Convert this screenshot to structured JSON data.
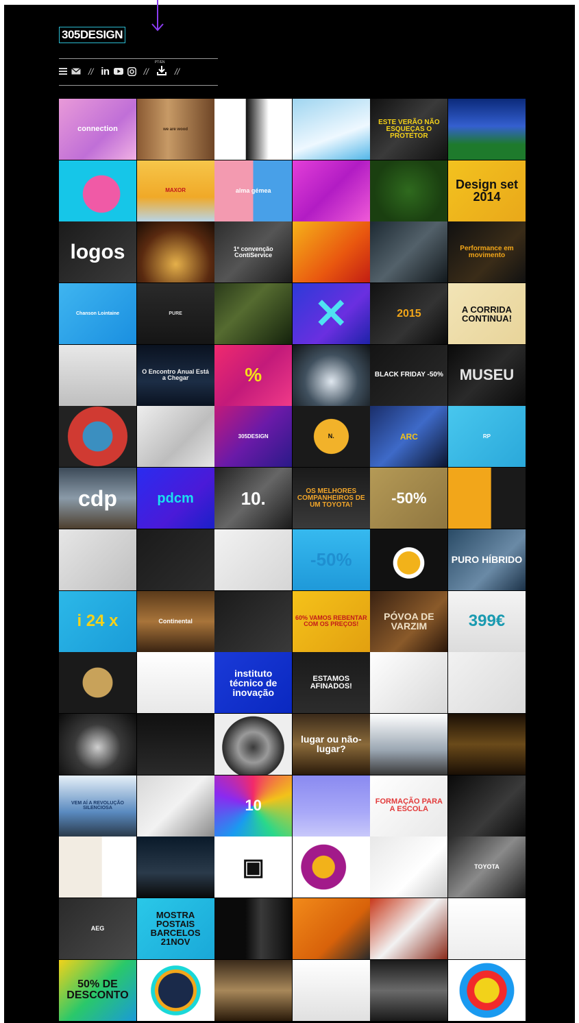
{
  "header": {
    "logo_text": "305DESIGN",
    "menu": {
      "hamburger_icon": "hamburger-icon",
      "mail_icon": "mail-icon",
      "sep1": "//",
      "linkedin_text": "in",
      "youtube_icon": "youtube-icon",
      "instagram_icon": "instagram-icon",
      "sep2": "//",
      "download_caption": "PT/EN",
      "download_icon": "download-icon",
      "sep3": "//"
    }
  },
  "colors": {
    "background": "#000000",
    "accent_cyan": "#2bbcd2",
    "arrow_purple": "#8a3cf0"
  },
  "tiles": [
    {
      "text": "connection",
      "bg": "linear-gradient(135deg,#e99ad8,#c06fd7 60%,#f1b1e4)",
      "fg": "#ffffff",
      "size": 11
    },
    {
      "text": "we are wood",
      "bg": "linear-gradient(90deg,#8a5a33,#c79a66 40%,#6e4526)",
      "fg": "#3a2412",
      "size": 6
    },
    {
      "text": "",
      "bg": "linear-gradient(90deg,#ffffff 40%,#111111 41%,#ffffff 70%)",
      "fg": "#000",
      "size": 9
    },
    {
      "text": "",
      "bg": "linear-gradient(160deg,#9fd5f0,#eef8ff 60%,#52b6e8)",
      "fg": "#000",
      "size": 9
    },
    {
      "text": "ESTE VERÃO NÃO ESQUEÇAS O PROTETOR",
      "bg": "linear-gradient(135deg,#111,#3a3a3a 50%,#111)",
      "fg": "#f5d21a",
      "size": 10
    },
    {
      "text": "",
      "bg": "linear-gradient(180deg,#0b2a7a,#345fd0 45%,#1e7a2c 75%)",
      "fg": "#fff",
      "size": 9
    },
    {
      "text": "",
      "bg": "radial-gradient(circle at 55% 55%,#f05aa6 0 34%,#16c6e8 35%)",
      "fg": "#fff",
      "size": 9
    },
    {
      "text": "MAXOR",
      "bg": "linear-gradient(180deg,#f6c64a,#f0a928 60%,#b8d4e6)",
      "fg": "#c2161b",
      "size": 8
    },
    {
      "text": "alma gémea",
      "bg": "linear-gradient(90deg,#f39ab0 50%,#48a0e8 50%)",
      "fg": "#ffffff",
      "size": 9
    },
    {
      "text": "",
      "bg": "linear-gradient(135deg,#e33fd8,#b21cc4 50%,#f05ad8)",
      "fg": "#fff",
      "size": 9
    },
    {
      "text": "",
      "bg": "radial-gradient(circle at 50% 50%,#2f6a1e,#1a3f10 70%)",
      "fg": "#fff",
      "size": 9
    },
    {
      "text": "Design set 2014",
      "bg": "linear-gradient(135deg,#f3c21f,#e9a81a)",
      "fg": "#111111",
      "size": 18
    },
    {
      "text": "logos",
      "bg": "linear-gradient(135deg,#1b1b1b,#3b3b3b)",
      "fg": "#ffffff",
      "size": 30
    },
    {
      "text": "",
      "bg": "radial-gradient(circle at 50% 70%,#e5b04a,#5a2a10 60%,#1a0d05)",
      "fg": "#fff",
      "size": 9
    },
    {
      "text": "1º convenção ContiService",
      "bg": "linear-gradient(135deg,#2d2d2d,#555 50%,#1c1c1c)",
      "fg": "#ffffff",
      "size": 9
    },
    {
      "text": "",
      "bg": "linear-gradient(135deg,#f6b21a,#e9570f 60%,#c21d13)",
      "fg": "#fff",
      "size": 9
    },
    {
      "text": "",
      "bg": "linear-gradient(135deg,#1d2a33,#53616a 50%,#12181c)",
      "fg": "#fff",
      "size": 9
    },
    {
      "text": "Performance em movimento",
      "bg": "linear-gradient(135deg,#111,#3a2c18 60%,#111)",
      "fg": "#f2a619",
      "size": 10
    },
    {
      "text": "Chanson Lointaine",
      "bg": "linear-gradient(135deg,#3fb5f0,#1a8fe0)",
      "fg": "#ffffff",
      "size": 7
    },
    {
      "text": "PURE",
      "bg": "linear-gradient(180deg,#2a2a2a,#151515)",
      "fg": "#dddddd",
      "size": 7
    },
    {
      "text": "",
      "bg": "linear-gradient(135deg,#2a3a1a,#556b30 40%,#14220c)",
      "fg": "#fff",
      "size": 9
    },
    {
      "text": "✕",
      "bg": "linear-gradient(135deg,#2c3ad8,#6a2fe0 60%,#1d22a8)",
      "fg": "#4fe2f2",
      "size": 60
    },
    {
      "text": "2015",
      "bg": "linear-gradient(135deg,#111,#333 60%,#0a0a0a)",
      "fg": "#f2a619",
      "size": 16
    },
    {
      "text": "A CORRIDA CONTINUA!",
      "bg": "linear-gradient(135deg,#f2e4b6,#e8d49a)",
      "fg": "#111111",
      "size": 13
    },
    {
      "text": "",
      "bg": "linear-gradient(180deg,#e8e8e8,#bfbfbf)",
      "fg": "#000",
      "size": 9
    },
    {
      "text": "O Encontro Anual Está a Chegar",
      "bg": "linear-gradient(180deg,#0a1220,#1c2d45 60%,#0a1220)",
      "fg": "#f0f0f0",
      "size": 9
    },
    {
      "text": "%",
      "bg": "linear-gradient(135deg,#f02a6e,#c31a7a 50%,#f03a88)",
      "fg": "#f5e11a",
      "size": 28
    },
    {
      "text": "",
      "bg": "radial-gradient(circle at 50% 60%,#dfe7ef,#40505e 50%,#101418)",
      "fg": "#fff",
      "size": 9
    },
    {
      "text": "BLACK FRIDAY -50%",
      "bg": "linear-gradient(135deg,#141414,#2b2b2b)",
      "fg": "#ffffff",
      "size": 10
    },
    {
      "text": "MUSEU",
      "bg": "linear-gradient(135deg,#0a0a0a,#2a2a2a 50%,#0a0a0a)",
      "fg": "#e6e6e6",
      "size": 22
    },
    {
      "text": "",
      "bg": "radial-gradient(circle at 50% 50%,#3b8fc0 0 30%,#d03a32 31%,#d03a32 60%,#222 61%)",
      "fg": "#fff",
      "size": 9
    },
    {
      "text": "",
      "bg": "linear-gradient(135deg,#eeeeee,#bdbdbd 60%,#e6e6e6)",
      "fg": "#000",
      "size": 9
    },
    {
      "text": "305DESIGN",
      "bg": "linear-gradient(135deg,#c21a7a,#6a1aa8 50%,#2a1a88)",
      "fg": "#ffffff",
      "size": 8
    },
    {
      "text": "N.",
      "bg": "radial-gradient(circle at 50% 50%,#f2b22a 0 35%,#1a1a1a 36%)",
      "fg": "#111111",
      "size": 9
    },
    {
      "text": "ARC",
      "bg": "linear-gradient(135deg,#1a2e6a,#3e6ac8 50%,#0c1630)",
      "fg": "#f2c21a",
      "size": 12
    },
    {
      "text": "RP",
      "bg": "linear-gradient(135deg,#48c7ee,#2aa8da)",
      "fg": "#ffffff",
      "size": 8
    },
    {
      "text": "cdp",
      "bg": "linear-gradient(180deg,#3c4a58,#8a9aa8 50%,#4d3f2e)",
      "fg": "#ffffff",
      "size": 32
    },
    {
      "text": "pdcm",
      "bg": "linear-gradient(135deg,#2a2cf0,#4a1ad8 60%,#1a20c8)",
      "fg": "#19e0f0",
      "size": 20
    },
    {
      "text": "10.",
      "bg": "linear-gradient(135deg,#222,#666 50%,#1a1a1a)",
      "fg": "#ffffff",
      "size": 26
    },
    {
      "text": "OS MELHORES COMPANHEIROS DE UM TOYOTA!",
      "bg": "linear-gradient(180deg,#1a1a1a,#3a3a3a)",
      "fg": "#f2a62a",
      "size": 10
    },
    {
      "text": "-50%",
      "bg": "linear-gradient(135deg,#b59a56,#8f7640)",
      "fg": "#ffffff",
      "size": 22
    },
    {
      "text": "",
      "bg": "linear-gradient(90deg,#f2a61a 55%,#1a1a1a 56%)",
      "fg": "#fff",
      "size": 9
    },
    {
      "text": "",
      "bg": "linear-gradient(135deg,#e6e6e6,#bfbfbf)",
      "fg": "#000",
      "size": 9
    },
    {
      "text": "",
      "bg": "linear-gradient(135deg,#1a1a1a,#2e2e2e)",
      "fg": "#fff",
      "size": 9
    },
    {
      "text": "",
      "bg": "linear-gradient(135deg,#f2f2f2,#d5d5d5)",
      "fg": "#000",
      "size": 9
    },
    {
      "text": "-50%",
      "bg": "linear-gradient(180deg,#36b9ef,#1f99d9)",
      "fg": "#1f8fd0",
      "size": 26
    },
    {
      "text": "",
      "bg": "radial-gradient(circle at 50% 55%,#f2b21a 0 22%,#ffffff 23% 30%,#111 31%)",
      "fg": "#fff",
      "size": 9
    },
    {
      "text": "PURO HÍBRIDO",
      "bg": "linear-gradient(135deg,#2a4b66,#6a8aa6 60%,#1c3248)",
      "fg": "#ffffff",
      "size": 14
    },
    {
      "text": "i 24 x",
      "bg": "linear-gradient(135deg,#2cb8e8,#1a9cd8)",
      "fg": "#f5d21a",
      "size": 24
    },
    {
      "text": "Continental",
      "bg": "linear-gradient(180deg,#5a3a1a,#a8743a 50%,#3a2412)",
      "fg": "#ffffff",
      "size": 9
    },
    {
      "text": "",
      "bg": "linear-gradient(135deg,#1a1a1a,#3a3a3a)",
      "fg": "#fff",
      "size": 9
    },
    {
      "text": "60% VAMOS REBENTAR COM OS PREÇOS!",
      "bg": "linear-gradient(135deg,#f5c21a,#e2a010)",
      "fg": "#c21a1a",
      "size": 9
    },
    {
      "text": "PÓVOA DE VARZIM",
      "bg": "linear-gradient(135deg,#3a2212,#8a5a2a 60%,#2a160a)",
      "fg": "#f0e2c8",
      "size": 14
    },
    {
      "text": "399€",
      "bg": "linear-gradient(180deg,#f4f4f4,#dcdcdc)",
      "fg": "#1a9ab0",
      "size": 24
    },
    {
      "text": "",
      "bg": "radial-gradient(circle at 50% 50%,#c8a25a 0 30%,#1a1a1a 31%)",
      "fg": "#fff",
      "size": 9
    },
    {
      "text": "",
      "bg": "linear-gradient(180deg,#ffffff,#e8e8e8)",
      "fg": "#000",
      "size": 9
    },
    {
      "text": "instituto técnico de inovação",
      "bg": "linear-gradient(135deg,#1a3ad8,#0a28c0)",
      "fg": "#ffffff",
      "size": 14
    },
    {
      "text": "ESTAMOS AFINADOS!",
      "bg": "linear-gradient(180deg,#1a1a1a,#2c2c2c)",
      "fg": "#ffffff",
      "size": 11
    },
    {
      "text": "",
      "bg": "linear-gradient(135deg,#ffffff,#d8d8d8)",
      "fg": "#000",
      "size": 9
    },
    {
      "text": "",
      "bg": "linear-gradient(135deg,#f2f2f2,#dadada)",
      "fg": "#000",
      "size": 9
    },
    {
      "text": "",
      "bg": "radial-gradient(circle at 50% 55%,#cfcfcf,#3a3a3a 45%,#0a0a0a)",
      "fg": "#fff",
      "size": 9
    },
    {
      "text": "",
      "bg": "linear-gradient(180deg,#101010,#2a2a2a)",
      "fg": "#fff",
      "size": 9
    },
    {
      "text": "",
      "bg": "radial-gradient(circle at 50% 55%,#3a3a3a,#9a9a9a 30%,#2a2a2a 60%,#eeeeee 61%)",
      "fg": "#fff",
      "size": 9
    },
    {
      "text": "lugar ou não-lugar?",
      "bg": "linear-gradient(180deg,#3a2a1a,#8a6a3a 50%,#2a1a0a)",
      "fg": "#ffffff",
      "size": 14
    },
    {
      "text": "",
      "bg": "linear-gradient(180deg,#ffffff,#9aa6b2 60%,#3a3a3a)",
      "fg": "#000",
      "size": 9
    },
    {
      "text": "",
      "bg": "linear-gradient(180deg,#1a0f05,#6a4a1a 50%,#1a0f05)",
      "fg": "#fff",
      "size": 9
    },
    {
      "text": "VEM AÍ A REVOLUÇÃO SILENCIOSA",
      "bg": "linear-gradient(180deg,#e6f0f8,#5a8ac0 60%,#2a3a4a)",
      "fg": "#1a3a6a",
      "size": 7
    },
    {
      "text": "",
      "bg": "linear-gradient(135deg,#d8d8d8,#f2f2f2 50%,#8a8a8a)",
      "fg": "#000",
      "size": 9
    },
    {
      "text": "10",
      "bg": "conic-gradient(#f22a6a,#f2c21a,#2ad88a,#1a9af0,#8a2af0,#f22a6a)",
      "fg": "#ffffff",
      "size": 22
    },
    {
      "text": "",
      "bg": "linear-gradient(180deg,#8a8af0,#a8a8f8 60%,#c8c8fa)",
      "fg": "#fff",
      "size": 9
    },
    {
      "text": "FORMAÇÃO PARA A ESCOLA",
      "bg": "linear-gradient(135deg,#ffffff,#e8e8e8)",
      "fg": "#e23a3a",
      "size": 11
    },
    {
      "text": "",
      "bg": "linear-gradient(135deg,#0a0a0a,#3a3a3a 60%,#0a0a0a)",
      "fg": "#fff",
      "size": 9
    },
    {
      "text": "",
      "bg": "linear-gradient(90deg,#f2ece2 55%,#ffffff 56%)",
      "fg": "#000",
      "size": 9
    },
    {
      "text": "",
      "bg": "linear-gradient(180deg,#0a1a2a,#2a3a4a 60%,#0a0a0a)",
      "fg": "#fff",
      "size": 9
    },
    {
      "text": "▣",
      "bg": "#ffffff",
      "fg": "#111111",
      "size": 34
    },
    {
      "text": "",
      "bg": "radial-gradient(circle at 40% 50%,#f2b21a 0 20%,#a21a8a 21% 40%,#ffffff 41%)",
      "fg": "#fff",
      "size": 9
    },
    {
      "text": "",
      "bg": "linear-gradient(135deg,#e8e8e8,#ffffff 60%,#c8c8c8)",
      "fg": "#000",
      "size": 9
    },
    {
      "text": "TOYOTA",
      "bg": "linear-gradient(135deg,#2a2a2a,#8a8a8a 50%,#1a1a1a)",
      "fg": "#ffffff",
      "size": 9
    },
    {
      "text": "AEG",
      "bg": "linear-gradient(135deg,#2a2a2a,#4a4a4a)",
      "fg": "#ffffff",
      "size": 9
    },
    {
      "text": "MOSTRA POSTAIS BARCELOS 21NOV",
      "bg": "linear-gradient(135deg,#2ac8e8,#1aa8d8)",
      "fg": "#111111",
      "size": 13
    },
    {
      "text": "",
      "bg": "linear-gradient(90deg,#0a0a0a 40%,#3a3a3a 60%,#0a0a0a)",
      "fg": "#fff",
      "size": 9
    },
    {
      "text": "",
      "bg": "linear-gradient(135deg,#f28a1a,#d8620a 60%,#2a2a2a)",
      "fg": "#fff",
      "size": 9
    },
    {
      "text": "",
      "bg": "linear-gradient(135deg,#c8381a,#f2f2f2 50%,#8a2a1a)",
      "fg": "#fff",
      "size": 9
    },
    {
      "text": "",
      "bg": "linear-gradient(180deg,#ffffff,#ededed)",
      "fg": "#000",
      "size": 9
    },
    {
      "text": "50% DE DESCONTO",
      "bg": "linear-gradient(135deg,#f2d21a,#2ac86a 50%,#1a9ad8)",
      "fg": "#111111",
      "size": 16
    },
    {
      "text": "",
      "bg": "radial-gradient(circle at 50% 50%,#1a2a4a 0 35%,#f2a61a 36% 42%,#1ad8d8 43% 50%,#ffffff 51%)",
      "fg": "#fff",
      "size": 9
    },
    {
      "text": "",
      "bg": "linear-gradient(180deg,#3a2a1a,#a8885a 50%,#2a1a0a)",
      "fg": "#fff",
      "size": 9
    },
    {
      "text": "",
      "bg": "linear-gradient(180deg,#ffffff,#e0e0e0)",
      "fg": "#000",
      "size": 9
    },
    {
      "text": "",
      "bg": "linear-gradient(180deg,#1a1a1a,#6a6a6a 50%,#1a1a1a)",
      "fg": "#fff",
      "size": 9
    },
    {
      "text": "",
      "bg": "radial-gradient(circle at 50% 50%,#f2d21a 0 25%,#f22a2a 26% 40%,#1a9af0 41% 55%,#ffffff 56%)",
      "fg": "#fff",
      "size": 9
    }
  ]
}
